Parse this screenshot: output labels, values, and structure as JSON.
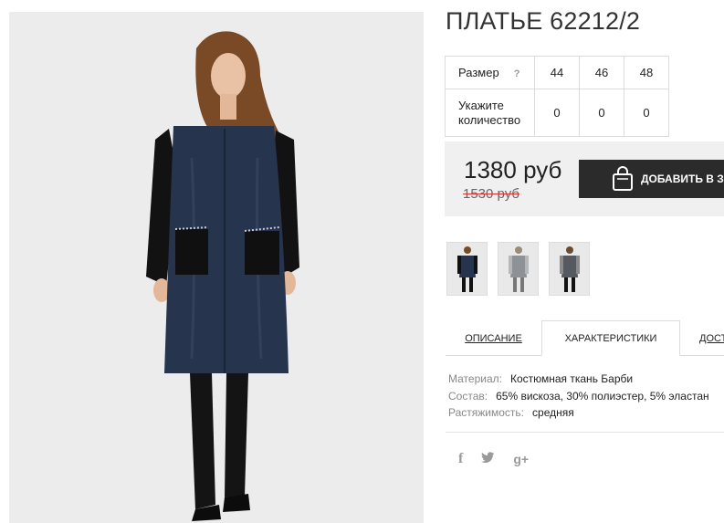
{
  "product": {
    "title": "ПЛАТЬЕ 62212/2"
  },
  "size_table": {
    "size_label": "Размер",
    "help_badge": "?",
    "sizes": [
      "44",
      "46",
      "48"
    ],
    "quantity_label_line1": "Укажите",
    "quantity_label_line2": "количество",
    "quantities": [
      "0",
      "0",
      "0"
    ]
  },
  "price": {
    "current": "1380 руб",
    "old": "1530 руб",
    "add_to_cart": "ДОБАВИТЬ В ЗАКАЗ"
  },
  "tabs": [
    {
      "label": "ОПИСАНИЕ"
    },
    {
      "label": "ХАРАКТЕРИСТИКИ"
    },
    {
      "label": "ДОСТАВКА"
    }
  ],
  "specs": [
    {
      "key": "Материал:",
      "value": "Костюмная ткань Барби"
    },
    {
      "key": "Состав:",
      "value": "65% вискоза, 30% полиэстер, 5% эластан"
    },
    {
      "key": "Растяжимость:",
      "value": "средняя"
    }
  ],
  "social": {
    "facebook": "f",
    "twitter": "t",
    "googleplus": "g+"
  },
  "icons": {
    "cart": "shopping-bag-icon",
    "facebook": "facebook-icon",
    "twitter": "twitter-icon",
    "googleplus": "google-plus-icon"
  },
  "colors": {
    "button_bg": "#2b2b2b",
    "price_box_bg": "#f0f0f0",
    "strike": "#dd3333"
  }
}
